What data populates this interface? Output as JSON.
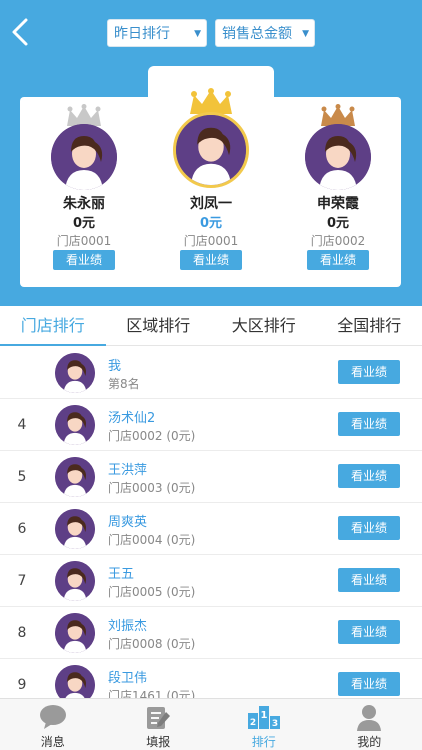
{
  "header": {
    "back_icon": "chevron-left-icon",
    "dropdowns": [
      {
        "label": "昨日排行",
        "caret": "▼"
      },
      {
        "label": "销售总金额",
        "caret": "▼"
      }
    ]
  },
  "podium": [
    {
      "place": 2,
      "name": "朱永丽",
      "amount": "0元",
      "store": "门店0001",
      "button": "看业绩",
      "crown_color": "#c8c8c8"
    },
    {
      "place": 1,
      "name": "刘凤一",
      "amount": "0元",
      "store": "门店0001",
      "button": "看业绩",
      "crown_color": "#f2c33a"
    },
    {
      "place": 3,
      "name": "申荣霞",
      "amount": "0元",
      "store": "门店0002",
      "button": "看业绩",
      "crown_color": "#c98a4a"
    }
  ],
  "tabs": [
    "门店排行",
    "区域排行",
    "大区排行",
    "全国排行"
  ],
  "me": {
    "name": "我",
    "rank_text": "第8名",
    "button": "看业绩"
  },
  "rows": [
    {
      "rank": "4",
      "name": "汤术仙2",
      "sub": "门店0002 (0元)",
      "button": "看业绩"
    },
    {
      "rank": "5",
      "name": "王洪萍",
      "sub": "门店0003 (0元)",
      "button": "看业绩"
    },
    {
      "rank": "6",
      "name": "周爽英",
      "sub": "门店0004 (0元)",
      "button": "看业绩"
    },
    {
      "rank": "7",
      "name": "王五",
      "sub": "门店0005 (0元)",
      "button": "看业绩"
    },
    {
      "rank": "8",
      "name": "刘振杰",
      "sub": "门店0008 (0元)",
      "button": "看业绩"
    },
    {
      "rank": "9",
      "name": "段卫伟",
      "sub": "门店1461 (0元)",
      "button": "看业绩"
    }
  ],
  "bottom_nav": [
    {
      "label": "消息",
      "icon": "message-icon"
    },
    {
      "label": "填报",
      "icon": "edit-report-icon"
    },
    {
      "label": "排行",
      "icon": "ranking-icon",
      "active": true
    },
    {
      "label": "我的",
      "icon": "user-icon"
    }
  ],
  "colors": {
    "primary": "#47a9e0",
    "gold": "#f2c33a",
    "silver": "#c8c8c8",
    "bronze": "#c98a4a"
  }
}
